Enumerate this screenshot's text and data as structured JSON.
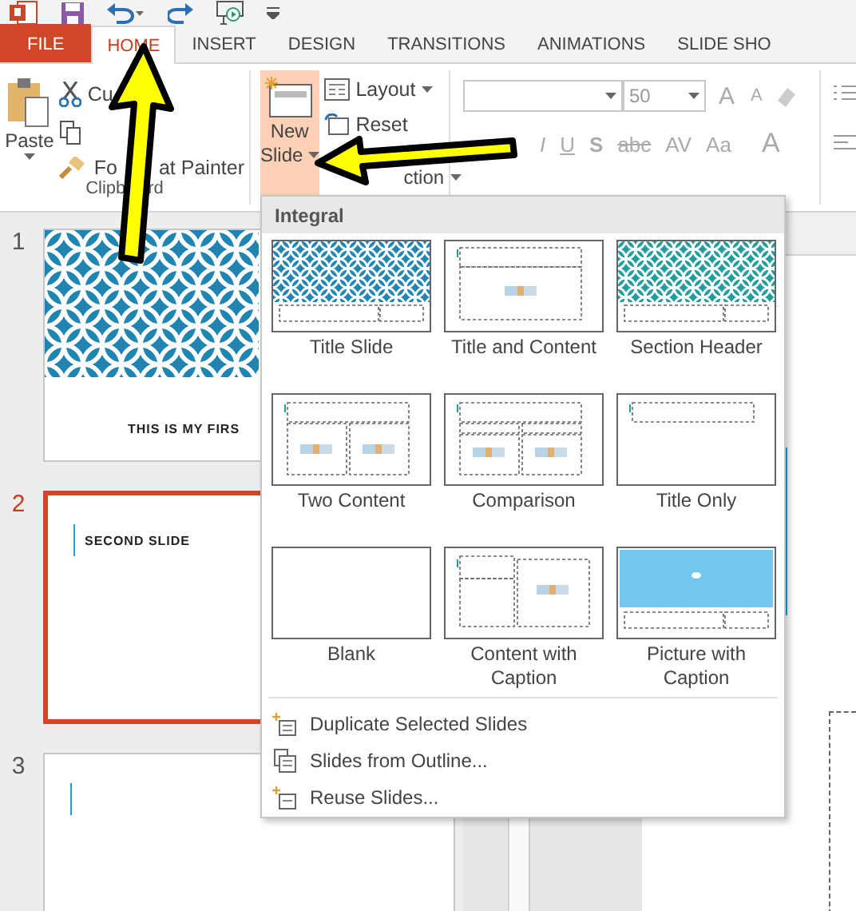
{
  "tabs": [
    {
      "label": "FILE",
      "kind": "file",
      "selected": false
    },
    {
      "label": "HOME",
      "kind": "tab",
      "selected": true
    },
    {
      "label": "INSERT",
      "kind": "tab",
      "selected": false
    },
    {
      "label": "DESIGN",
      "kind": "tab",
      "selected": false
    },
    {
      "label": "TRANSITIONS",
      "kind": "tab",
      "selected": false
    },
    {
      "label": "ANIMATIONS",
      "kind": "tab",
      "selected": false
    },
    {
      "label": "SLIDE SHO",
      "kind": "tab",
      "selected": false
    }
  ],
  "clipboard": {
    "paste": "Paste",
    "cut": "Cu",
    "format_painter": [
      "Fo",
      "at Painter"
    ],
    "group_label": [
      "Clipb",
      "rd"
    ]
  },
  "slides_group": {
    "new_slide": {
      "lines": [
        "New",
        "Slide"
      ],
      "pressed": true
    },
    "layout": "Layout",
    "reset": "Reset",
    "section": "ction"
  },
  "font_group": {
    "size": "50",
    "grow": "A",
    "shrink": "A",
    "styles": [
      "I",
      "U",
      "S",
      "abc",
      "AV",
      "Aa"
    ],
    "font_color": "A"
  },
  "slides_pane": [
    {
      "number": "1",
      "kind": "title",
      "title": "THIS IS MY FIRS",
      "selected": false
    },
    {
      "number": "2",
      "kind": "content",
      "title": "SECOND SLIDE",
      "selected": true
    },
    {
      "number": "3",
      "kind": "content",
      "selected": false
    }
  ],
  "layout_menu": {
    "title": "Integral",
    "layouts": [
      {
        "label": "Title Slide",
        "kind": "title"
      },
      {
        "label": "Title and Content",
        "kind": "title-content"
      },
      {
        "label": "Section Header",
        "kind": "section"
      },
      {
        "label": "Two Content",
        "kind": "two-content"
      },
      {
        "label": "Comparison",
        "kind": "comparison"
      },
      {
        "label": "Title Only",
        "kind": "title-only"
      },
      {
        "label": "Blank",
        "kind": "blank"
      },
      {
        "label": "Content with Caption",
        "kind": "content-caption"
      },
      {
        "label": "Picture with Caption",
        "kind": "picture-caption"
      }
    ],
    "commands": [
      {
        "label": "Duplicate Selected Slides",
        "kind": "duplicate"
      },
      {
        "label": "Slides from Outline...",
        "kind": "outline"
      },
      {
        "label": "Reuse Slides...",
        "kind": "reuse"
      }
    ]
  }
}
